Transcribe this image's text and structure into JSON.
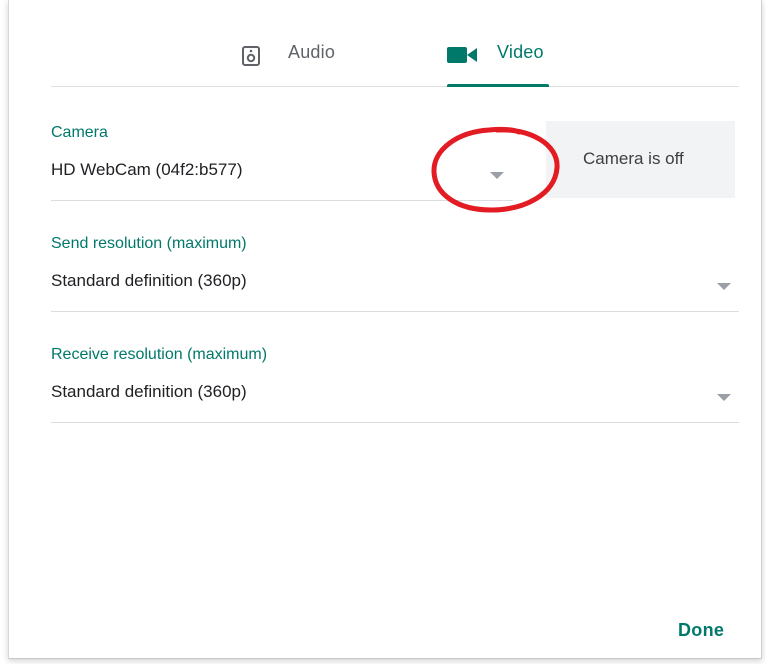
{
  "tabs": [
    {
      "label": "Audio",
      "icon": "speaker-icon",
      "selected": false
    },
    {
      "label": "Video",
      "icon": "video-camera-icon",
      "selected": true
    }
  ],
  "camera": {
    "label": "Camera",
    "value": "HD WebCam (04f2:b577)",
    "preview_text": "Camera is off"
  },
  "send_resolution": {
    "label": "Send resolution (maximum)",
    "value": "Standard definition (360p)"
  },
  "receive_resolution": {
    "label": "Receive resolution (maximum)",
    "value": "Standard definition (360p)"
  },
  "done_label": "Done",
  "colors": {
    "accent": "#00796b",
    "annotation": "#e31b23",
    "preview_bg": "#f1f3f4"
  }
}
